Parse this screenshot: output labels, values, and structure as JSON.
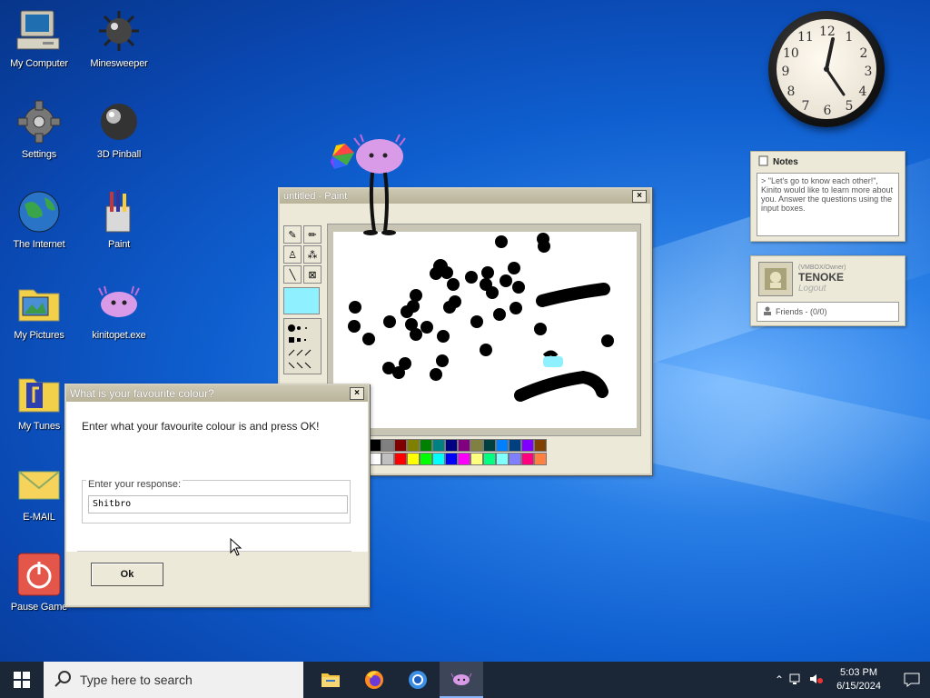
{
  "desktop_icons": [
    {
      "label": "My Computer",
      "icon": "computer-icon"
    },
    {
      "label": "Minesweeper",
      "icon": "mine-icon"
    },
    {
      "label": "Settings",
      "icon": "gear-icon"
    },
    {
      "label": "3D Pinball",
      "icon": "pinball-icon"
    },
    {
      "label": "The Internet",
      "icon": "globe-icon"
    },
    {
      "label": "Paint",
      "icon": "paint-icon"
    },
    {
      "label": "My Pictures",
      "icon": "pictures-folder-icon"
    },
    {
      "label": "kinitopet.exe",
      "icon": "kinito-icon"
    },
    {
      "label": "My Tunes",
      "icon": "music-folder-icon"
    },
    {
      "label": "E-MAIL",
      "icon": "mail-icon"
    },
    {
      "label": "Pause Game",
      "icon": "power-icon"
    }
  ],
  "notes": {
    "title": "Notes",
    "text": "> \"Let's go to know each other!\", Kinito would like to learn more about you. Answer the questions using the input boxes."
  },
  "profile": {
    "small": "(VMBOX/Owner)",
    "name": "TENOKE",
    "logout": "Logout",
    "friends": "Friends - (0/0)"
  },
  "paint": {
    "title": "untitled - Paint"
  },
  "dialog": {
    "title": "What is your favourite colour?",
    "prompt": "Enter what your favourite colour is and press OK!",
    "group_label": "Enter your response:",
    "input_value": "Shitbro",
    "ok_label": "Ok"
  },
  "taskbar": {
    "search_placeholder": "Type here to search",
    "time": "5:03 PM",
    "date": "6/15/2024"
  },
  "colors": {
    "palette": [
      "#000000",
      "#808080",
      "#800000",
      "#808000",
      "#008000",
      "#008080",
      "#000080",
      "#800080",
      "#808040",
      "#004040",
      "#0080ff",
      "#004080",
      "#8000ff",
      "#804000",
      "#ffffff",
      "#c0c0c0",
      "#ff0000",
      "#ffff00",
      "#00ff00",
      "#00ffff",
      "#0000ff",
      "#ff00ff",
      "#ffff80",
      "#00ff80",
      "#80ffff",
      "#8080ff",
      "#ff0080",
      "#ff8040"
    ]
  }
}
